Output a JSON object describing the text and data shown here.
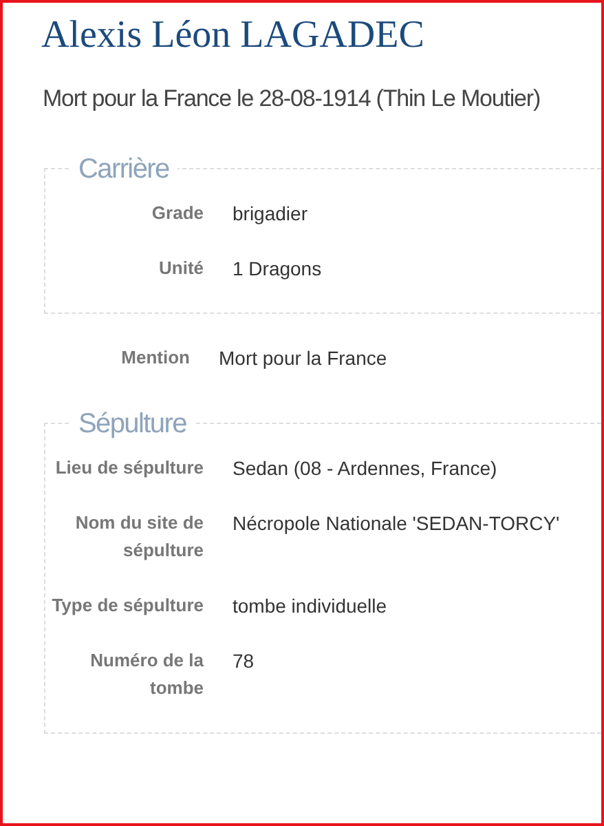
{
  "name": "Alexis Léon LAGADEC",
  "subtitle": "Mort pour la France le 28-08-1914 (Thin Le Moutier)",
  "sections": [
    {
      "kind": "group",
      "legend": "Carrière",
      "rows": [
        {
          "label": "Grade",
          "value": "brigadier"
        },
        {
          "label": "Unité",
          "value": "1 Dragons"
        }
      ]
    },
    {
      "kind": "plain",
      "rows": [
        {
          "label": "Mention",
          "value": "Mort pour la France"
        }
      ]
    },
    {
      "kind": "group",
      "legend": "Sépulture",
      "rows": [
        {
          "label": "Lieu de sépulture",
          "value": "Sedan (08 - Ardennes, France)"
        },
        {
          "label": "Nom du site de sépulture",
          "value": "Nécropole Nationale 'SEDAN-TORCY'"
        },
        {
          "label": "Type de sépulture",
          "value": "tombe individuelle"
        },
        {
          "label": "Numéro de la tombe",
          "value": "78"
        }
      ]
    }
  ]
}
